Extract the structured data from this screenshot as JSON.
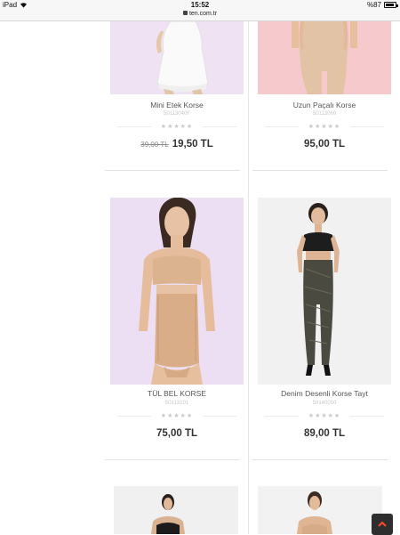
{
  "status_bar": {
    "device": "iPad",
    "time": "15:52",
    "battery": "%87"
  },
  "browser": {
    "url": "ten.com.tr"
  },
  "products": [
    {
      "name": "Mini Etek Korse",
      "code": "50113040F",
      "old_price": "39,00 TL",
      "price": "19,50 TL",
      "image": "white-mini-skirt-shapewear"
    },
    {
      "name": "Uzun Paçalı Korse",
      "code": "50113060",
      "old_price": "",
      "price": "95,00 TL",
      "image": "nude-long-leg-shapewear"
    },
    {
      "name": "TÜL BEL KORSE",
      "code": "50113101",
      "old_price": "",
      "price": "75,00 TL",
      "image": "tulle-waist-corset"
    },
    {
      "name": "Denim Desenli Korse Tayt",
      "code": "50140050",
      "old_price": "",
      "price": "89,00 TL",
      "image": "denim-pattern-leggings"
    },
    {
      "name": "",
      "code": "",
      "old_price": "",
      "price": "",
      "image": "black-shapewear-partial"
    },
    {
      "name": "",
      "code": "",
      "old_price": "",
      "price": "",
      "image": "nude-bodysuit-partial"
    }
  ],
  "rating_stars": "★★★★★",
  "scroll_top_icon": "chevron-up-icon"
}
